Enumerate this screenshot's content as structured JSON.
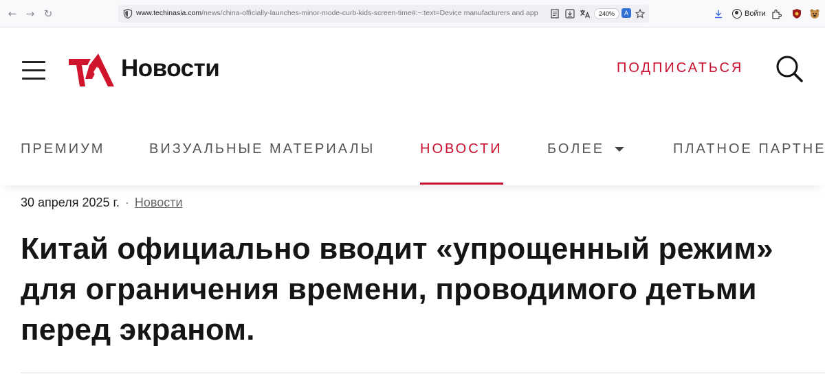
{
  "browser": {
    "url_host": "www.techinasia.com",
    "url_path": "/news/china-officially-launches-minor-mode-curb-kids-screen-time#:~:text=Device manufacturers and app sto",
    "zoom_level": "240%",
    "signin_label": "Войти",
    "icons": [
      "back-icon",
      "forward-icon",
      "reload-icon",
      "shield-icon",
      "reader-view-icon",
      "save-page-icon",
      "translate-icon",
      "bookmark-star-icon",
      "download-icon",
      "account-icon",
      "extensions-icon",
      "addon-icon"
    ]
  },
  "header": {
    "brand": "Новости",
    "subscribe_label": "ПОДПИСАТЬСЯ",
    "brand_color": "#c8102e"
  },
  "nav": {
    "items": [
      {
        "label": "ПРЕМИУМ"
      },
      {
        "label": "ВИЗУАЛЬНЫЕ МАТЕРИАЛЫ"
      },
      {
        "label": "НОВОСТИ",
        "active": true
      },
      {
        "label": "БОЛЕЕ"
      },
      {
        "label": "ПЛАТНОЕ ПАРТНЕ"
      }
    ]
  },
  "article": {
    "date": "30 апреля 2025 г.",
    "separator": "·",
    "category": "Новости",
    "headline": "Китай официально вводит «упрощенный режим» для ограничения времени, проводимого детьми перед экраном."
  }
}
